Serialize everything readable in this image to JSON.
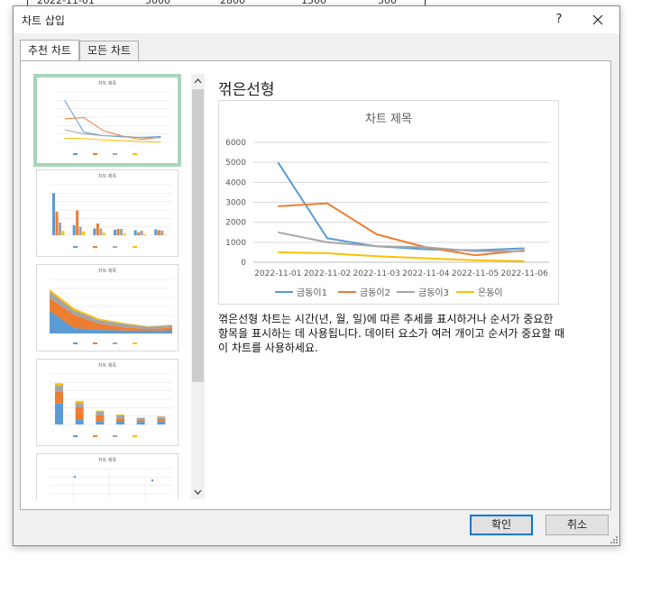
{
  "background_sheet": {
    "cells": [
      "2022-11-01",
      "5000",
      "2800",
      "1500",
      "500"
    ]
  },
  "dialog": {
    "title": "차트 삽입",
    "help_label": "?",
    "tabs": [
      {
        "label": "추천 차트",
        "active": true
      },
      {
        "label": "모든 차트",
        "active": false
      }
    ],
    "thumbnails": [
      {
        "title": "차트 제목",
        "kind": "line",
        "selected": true
      },
      {
        "title": "차트 제목",
        "kind": "clustered-column",
        "selected": false
      },
      {
        "title": "차트 제목",
        "kind": "stacked-area",
        "selected": false
      },
      {
        "title": "차트 제목",
        "kind": "stacked-column",
        "selected": false
      },
      {
        "title": "차트 제목",
        "kind": "scatter",
        "selected": false
      }
    ],
    "detail": {
      "chart_type_name": "꺾은선형",
      "description_lines": [
        "꺾은선형 차트는 시간(년, 월, 일)에 따른 추세를 표시하거나 순서가 중요한",
        "항목을 표시하는 데 사용됩니다. 데이터 요소가 여러 개이고 순서가 중요할 때",
        "이 차트를 사용하세요."
      ]
    },
    "buttons": {
      "ok": "확인",
      "cancel": "취소"
    }
  },
  "chart_data": {
    "type": "line",
    "title": "차트 제목",
    "categories": [
      "2022-11-01",
      "2022-11-02",
      "2022-11-03",
      "2022-11-04",
      "2022-11-05",
      "2022-11-06"
    ],
    "ylim": [
      0,
      6000
    ],
    "yticks": [
      0,
      1000,
      2000,
      3000,
      4000,
      5000,
      6000
    ],
    "grid": true,
    "legend": "bottom",
    "series": [
      {
        "name": "금동이1",
        "color": "#5b9bd5",
        "values": [
          5000,
          1200,
          800,
          650,
          600,
          700
        ]
      },
      {
        "name": "금동이2",
        "color": "#ed7d31",
        "values": [
          2800,
          2950,
          1400,
          750,
          350,
          600
        ]
      },
      {
        "name": "금동이3",
        "color": "#a5a5a5",
        "values": [
          1500,
          1000,
          800,
          750,
          550,
          550
        ]
      },
      {
        "name": "은동이",
        "color": "#ffc000",
        "values": [
          500,
          450,
          300,
          200,
          100,
          50
        ]
      }
    ]
  },
  "thumbnail_data": {
    "bar_values": [
      [
        5000,
        2800,
        1500,
        500
      ],
      [
        1200,
        2950,
        1000,
        450
      ],
      [
        800,
        1400,
        800,
        300
      ],
      [
        650,
        750,
        750,
        200
      ],
      [
        600,
        350,
        550,
        100
      ],
      [
        700,
        600,
        550,
        50
      ]
    ]
  }
}
